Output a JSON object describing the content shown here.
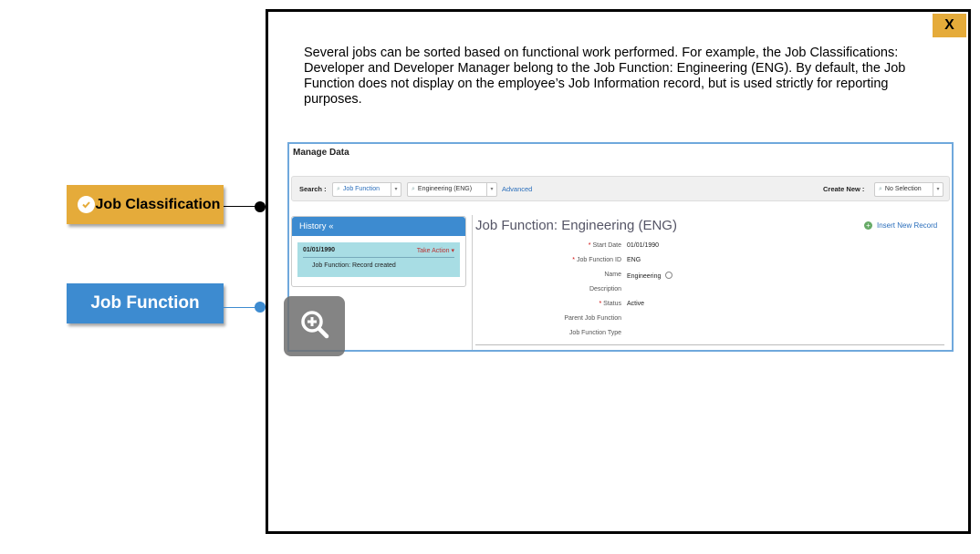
{
  "labels": {
    "job_classification": "Job Classification",
    "job_function": "Job Function"
  },
  "popup": {
    "close_label": "X",
    "intro_text": "Several jobs can be sorted based on functional work performed. For example, the Job Classifications: Developer and Developer Manager belong to the Job Function: Engineering (ENG). By default, the Job Function does not display on the employee’s Job Information record, but is used strictly for reporting purposes."
  },
  "screenshot": {
    "title": "Manage Data",
    "search_label": "Search :",
    "search_type": "Job Function",
    "search_value": "Engineering (ENG)",
    "advanced_label": "Advanced",
    "create_new_label": "Create New :",
    "create_new_value": "No Selection",
    "history": {
      "header": "History «",
      "date": "01/01/1990",
      "action": "Take Action ▾",
      "note": "Job Function: Record created"
    },
    "detail": {
      "title": "Job Function: Engineering (ENG)",
      "insert_label": "Insert New Record",
      "fields": [
        {
          "label": "Start Date",
          "value": "01/01/1990",
          "required": "*"
        },
        {
          "label": "Job Function ID",
          "value": "ENG",
          "required": "*"
        },
        {
          "label": "Name",
          "value": "Engineering",
          "required": ""
        },
        {
          "label": "Description",
          "value": "",
          "required": ""
        },
        {
          "label": "Status",
          "value": "Active",
          "required": "*"
        },
        {
          "label": "Parent Job Function",
          "value": "",
          "required": ""
        },
        {
          "label": "Job Function Type",
          "value": "",
          "required": ""
        }
      ]
    }
  },
  "colors": {
    "accent_gold": "#e5ab3a",
    "accent_blue": "#3d8bd0"
  },
  "icons": [
    "check-circle-icon",
    "zoom-in-icon",
    "close-icon",
    "globe-icon",
    "plus-circle-icon"
  ]
}
